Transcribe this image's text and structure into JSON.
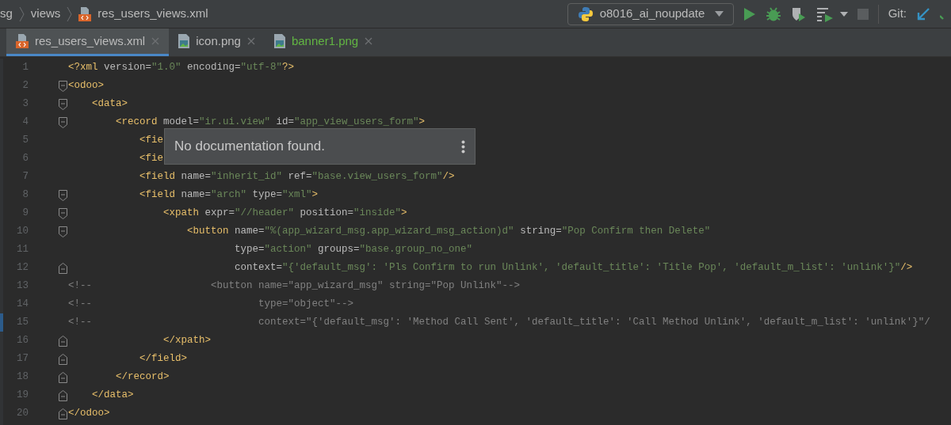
{
  "breadcrumbs": [
    {
      "label": "sg",
      "kind": "folder"
    },
    {
      "label": "views",
      "kind": "folder"
    },
    {
      "label": "res_users_views.xml",
      "kind": "xml"
    }
  ],
  "run_config": {
    "label": "o8016_ai_noupdate"
  },
  "toolbar": {
    "stop_disabled": true,
    "vcs_label": "Git:"
  },
  "tabs": [
    {
      "label": "res_users_views.xml",
      "kind": "xml",
      "selected": true,
      "color": "#bbbbbb"
    },
    {
      "label": "icon.png",
      "kind": "image",
      "selected": false,
      "color": "#bbbbbb"
    },
    {
      "label": "banner1.png",
      "kind": "image",
      "selected": false,
      "color": "#62b543"
    }
  ],
  "lines": [
    {
      "number": "1",
      "kind": "plain",
      "tokens": [
        {
          "kind": "tag",
          "text": "<?xml "
        },
        {
          "kind": "attr",
          "text": "version="
        },
        {
          "kind": "value",
          "text": "\"1.0\""
        },
        {
          "kind": "attr",
          "text": " encoding="
        },
        {
          "kind": "value",
          "text": "\"utf-8\""
        },
        {
          "kind": "tag",
          "text": "?>"
        }
      ]
    },
    {
      "number": "2",
      "kind": "fold_start",
      "tokens": [
        {
          "kind": "tag",
          "text": "<odoo>"
        }
      ]
    },
    {
      "number": "3",
      "kind": "fold_start",
      "tokens": [
        {
          "kind": "tag",
          "text": "    <data>"
        }
      ]
    },
    {
      "number": "4",
      "kind": "fold_start",
      "tokens": [
        {
          "kind": "tag",
          "text": "        <record "
        },
        {
          "kind": "attr",
          "text": "model="
        },
        {
          "kind": "value",
          "text": "\"ir.ui.view\""
        },
        {
          "kind": "attr",
          "text": " id="
        },
        {
          "kind": "value",
          "text": "\"app_view_users_form\""
        },
        {
          "kind": "tag",
          "text": ">"
        }
      ]
    },
    {
      "number": "5",
      "kind": "plain",
      "tokens": [
        {
          "kind": "tag",
          "text": "            <fie"
        }
      ]
    },
    {
      "number": "6",
      "kind": "plain",
      "tokens": [
        {
          "kind": "tag",
          "text": "            <fie"
        }
      ]
    },
    {
      "number": "7",
      "kind": "plain",
      "tokens": [
        {
          "kind": "tag",
          "text": "            <field "
        },
        {
          "kind": "attr",
          "text": "name="
        },
        {
          "kind": "value",
          "text": "\"inherit_id\""
        },
        {
          "kind": "attr",
          "text": " ref="
        },
        {
          "kind": "value",
          "text": "\"base.view_users_form\""
        },
        {
          "kind": "tag",
          "text": "/>"
        }
      ]
    },
    {
      "number": "8",
      "kind": "fold_start",
      "tokens": [
        {
          "kind": "tag",
          "text": "            <field "
        },
        {
          "kind": "attr",
          "text": "name="
        },
        {
          "kind": "value",
          "text": "\"arch\""
        },
        {
          "kind": "attr",
          "text": " type="
        },
        {
          "kind": "value",
          "text": "\"xml\""
        },
        {
          "kind": "tag",
          "text": ">"
        }
      ]
    },
    {
      "number": "9",
      "kind": "fold_start",
      "tokens": [
        {
          "kind": "tag",
          "text": "                <xpath "
        },
        {
          "kind": "attr",
          "text": "expr="
        },
        {
          "kind": "value",
          "text": "\"//header\""
        },
        {
          "kind": "attr",
          "text": " position="
        },
        {
          "kind": "value",
          "text": "\"inside\""
        },
        {
          "kind": "tag",
          "text": ">"
        }
      ]
    },
    {
      "number": "10",
      "kind": "fold_start",
      "tokens": [
        {
          "kind": "tag",
          "text": "                    <button "
        },
        {
          "kind": "attr",
          "text": "name="
        },
        {
          "kind": "value",
          "text": "\"%(app_wizard_msg.app_wizard_msg_action)d\""
        },
        {
          "kind": "attr",
          "text": " string="
        },
        {
          "kind": "value",
          "text": "\"Pop Confirm then Delete\""
        }
      ]
    },
    {
      "number": "11",
      "kind": "plain",
      "tokens": [
        {
          "kind": "attr",
          "text": "                            type="
        },
        {
          "kind": "value",
          "text": "\"action\""
        },
        {
          "kind": "attr",
          "text": " groups="
        },
        {
          "kind": "value",
          "text": "\"base.group_no_one\""
        }
      ]
    },
    {
      "number": "12",
      "kind": "fold_end",
      "tokens": [
        {
          "kind": "attr",
          "text": "                            context="
        },
        {
          "kind": "value",
          "text": "\"{'default_msg': 'Pls Confirm to run Unlink', 'default_title': 'Title Pop', 'default_m_list': 'unlink'}\""
        },
        {
          "kind": "tag",
          "text": "/>"
        }
      ]
    },
    {
      "number": "13",
      "kind": "plain",
      "tokens": [
        {
          "kind": "comment",
          "text": "<!--                    <button name=\"app_wizard_msg\" string=\"Pop Unlink\"-->"
        }
      ]
    },
    {
      "number": "14",
      "kind": "plain",
      "tokens": [
        {
          "kind": "comment",
          "text": "<!--                            type=\"object\"-->"
        }
      ]
    },
    {
      "number": "15",
      "kind": "plain",
      "tokens": [
        {
          "kind": "comment",
          "text": "<!--                            context=\"{'default_msg': 'Method Call Sent', 'default_title': 'Call Method Unlink', 'default_m_list': 'unlink'}\"/"
        }
      ]
    },
    {
      "number": "16",
      "kind": "fold_end",
      "tokens": [
        {
          "kind": "tag",
          "text": "                </xpath>"
        }
      ]
    },
    {
      "number": "17",
      "kind": "fold_end",
      "tokens": [
        {
          "kind": "tag",
          "text": "            </field>"
        }
      ]
    },
    {
      "number": "18",
      "kind": "fold_end",
      "tokens": [
        {
          "kind": "tag",
          "text": "        </record>"
        }
      ]
    },
    {
      "number": "19",
      "kind": "fold_end",
      "tokens": [
        {
          "kind": "tag",
          "text": "    </data>"
        }
      ]
    },
    {
      "number": "20",
      "kind": "fold_end",
      "tokens": [
        {
          "kind": "tag",
          "text": "</odoo>"
        }
      ]
    }
  ],
  "doc_popup": {
    "text": "No documentation found."
  }
}
